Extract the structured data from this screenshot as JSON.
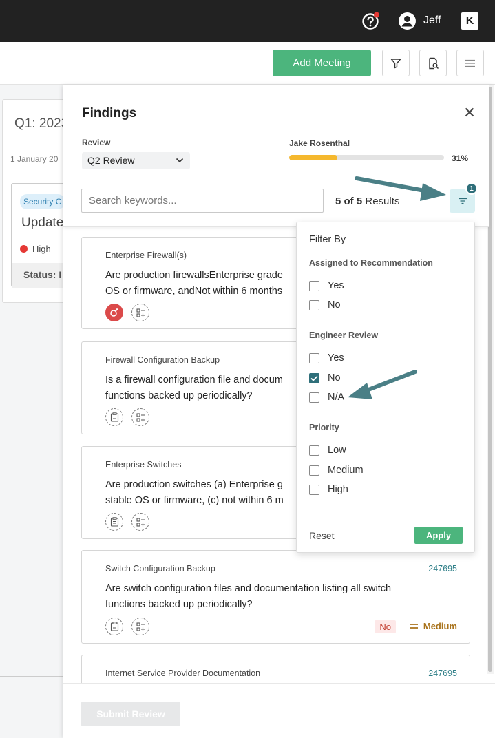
{
  "topbar": {
    "user_name": "Jeff",
    "brand_logo": "K"
  },
  "toolbar": {
    "add_meeting_label": "Add Meeting"
  },
  "background_card": {
    "title": "Q1: 2023",
    "date": "1 January 20",
    "tag": "Security C",
    "update_title": "Update",
    "priority": "High",
    "status_label": "Status: I"
  },
  "findings": {
    "title": "Findings",
    "review_label": "Review",
    "review_value": "Q2 Review",
    "reviewer_name": "Jake Rosenthal",
    "progress_percent": 31,
    "progress_label": "31%",
    "search_placeholder": "Search keywords...",
    "results_count": "5 of 5",
    "results_suffix": "Results",
    "filter_badge": "1",
    "submit_label": "Submit Review",
    "cards": [
      {
        "category": "Enterprise Firewall(s)",
        "question": "Are production firewallsEnterprise grade\nOS or firmware, andNot within 6 months",
        "id": "",
        "answer": "",
        "priority": ""
      },
      {
        "category": "Firewall Configuration Backup",
        "question": "Is a firewall configuration file and docum\nfunctions backed up periodically?",
        "id": "",
        "answer": "",
        "priority": ""
      },
      {
        "category": "Enterprise Switches",
        "question": "Are production switches (a) Enterprise g\nstable OS or firmware, (c) not within 6 m",
        "id": "",
        "answer": "",
        "priority": ""
      },
      {
        "category": "Switch Configuration Backup",
        "question": "Are switch configuration files and documentation listing all switch\nfunctions backed up periodically?",
        "id": "247695",
        "answer": "No",
        "priority": "Medium"
      },
      {
        "category": "Internet Service Provider Documentation",
        "question": "",
        "id": "247695",
        "answer": "",
        "priority": ""
      }
    ]
  },
  "filter_menu": {
    "title": "Filter By",
    "sections": [
      {
        "label": "Assigned to Recommendation",
        "options": [
          {
            "label": "Yes",
            "checked": false
          },
          {
            "label": "No",
            "checked": false
          }
        ]
      },
      {
        "label": "Engineer Review",
        "options": [
          {
            "label": "Yes",
            "checked": false
          },
          {
            "label": "No",
            "checked": true
          },
          {
            "label": "N/A",
            "checked": false
          }
        ]
      },
      {
        "label": "Priority",
        "options": [
          {
            "label": "Low",
            "checked": false
          },
          {
            "label": "Medium",
            "checked": false
          },
          {
            "label": "High",
            "checked": false
          }
        ]
      }
    ],
    "reset_label": "Reset",
    "apply_label": "Apply"
  },
  "colors": {
    "accent_green": "#4cb57d",
    "teal": "#2f6f7a",
    "progress": "#f5b82e",
    "annotation_arrow": "#4a7f86"
  }
}
